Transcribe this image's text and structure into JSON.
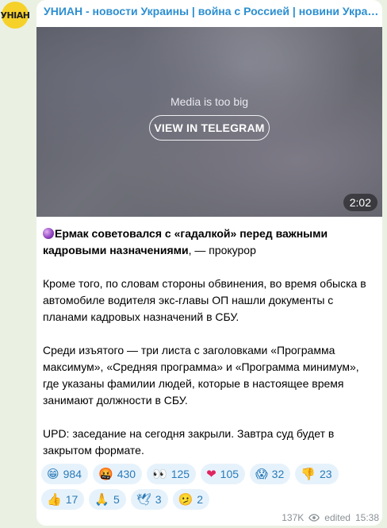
{
  "channel": {
    "avatar_text": "УНІАН",
    "name": "УНИАН - новости Украины | война с Россией | новини Україні..."
  },
  "media": {
    "note": "Media is too big",
    "button_label": "VIEW IN TELEGRAM",
    "duration": "2:02"
  },
  "message": {
    "headline_icon": "crystal-ball-icon",
    "headline_bold": "Ермак советовался с «гадалкой» перед важными кадровыми назначениями",
    "headline_rest": ", — прокурор",
    "paragraph_2": "Кроме того, по словам стороны обвинения, во время обыска в автомобиле водителя экс-главы ОП нашли документы с планами кадровых назначений в СБУ.",
    "paragraph_3": "Среди изъятого — три листа с заголовками «Программа максимум», «Средняя программа» и «Программа минимум», где указаны фамилии людей, которые в настоящее время занимают должности в СБУ.",
    "paragraph_4": "UPD: заседание на сегодня закрыли. Завтра суд будет в закрытом формате."
  },
  "reactions": [
    {
      "emoji": "😁",
      "count": "984"
    },
    {
      "emoji": "🤬",
      "count": "430"
    },
    {
      "emoji": "👀",
      "count": "125"
    },
    {
      "emoji": "❤",
      "count": "105"
    },
    {
      "emoji": "😱",
      "count": "32"
    },
    {
      "emoji": "👎",
      "count": "23"
    },
    {
      "emoji": "👍",
      "count": "17"
    },
    {
      "emoji": "🙏",
      "count": "5"
    },
    {
      "emoji": "🕊",
      "count": "3"
    },
    {
      "emoji": "🫤",
      "count": "2"
    }
  ],
  "footer": {
    "views": "137K",
    "edited_label": "edited",
    "time": "15:38"
  }
}
